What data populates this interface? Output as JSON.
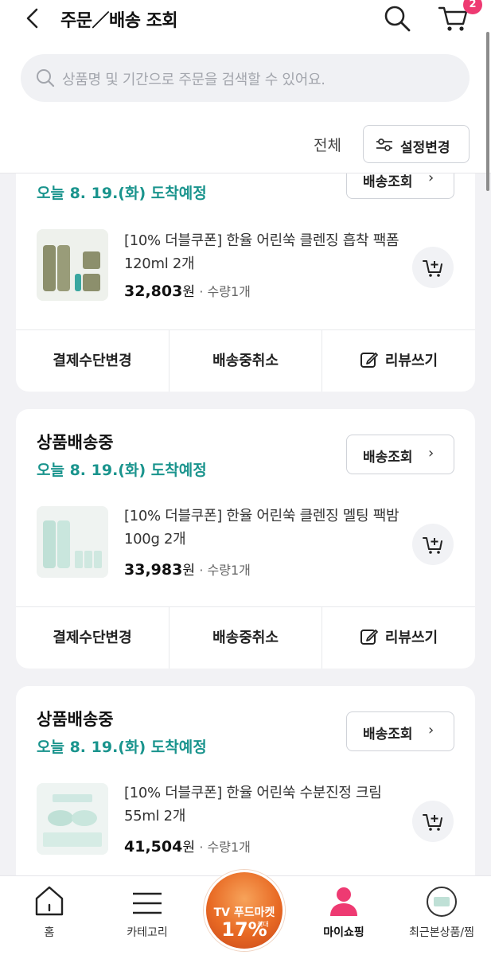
{
  "header": {
    "title": "주문／배송 조회",
    "cart_count": "2",
    "search_placeholder": "상품명 및 기간으로 주문을 검색할 수 있어요.",
    "filter_label": "전체",
    "settings_label": "설정변경"
  },
  "orders": [
    {
      "status": "",
      "eta": "오늘 8. 19.(화) 도착예정",
      "track_label": "배송조회",
      "product_name": "[10% 더블쿠폰] 한율 어린쑥 클렌징 흡착 팩폼 120ml 2개",
      "price": "32,803",
      "won": "원",
      "qty": "· 수량1개",
      "actions": [
        "결제수단변경",
        "배송중취소",
        "리뷰쓰기"
      ]
    },
    {
      "status": "상품배송중",
      "eta": "오늘 8. 19.(화) 도착예정",
      "track_label": "배송조회",
      "product_name": "[10% 더블쿠폰] 한율 어린쑥 클렌징 멜팅 팩밤 100g 2개",
      "price": "33,983",
      "won": "원",
      "qty": "· 수량1개",
      "actions": [
        "결제수단변경",
        "배송중취소",
        "리뷰쓰기"
      ]
    },
    {
      "status": "상품배송중",
      "eta": "오늘 8. 19.(화) 도착예정",
      "track_label": "배송조회",
      "product_name": "[10% 더블쿠폰] 한율 어린쑥 수분진정 크림 55ml 2개",
      "price": "41,504",
      "won": "원",
      "qty": "· 수량1개",
      "actions": []
    }
  ],
  "nav": {
    "items": [
      "홈",
      "카테고리",
      "마이쇼핑",
      "최근본상품/찜"
    ],
    "active": "마이쇼핑",
    "promo_line1": "TV 푸드마켓",
    "promo_line2": "17%",
    "promo_small": "최대"
  },
  "colors": {
    "accent_teal": "#1a948d",
    "badge_pink": "#ee3a72",
    "active_nav": "#ee3a72"
  }
}
